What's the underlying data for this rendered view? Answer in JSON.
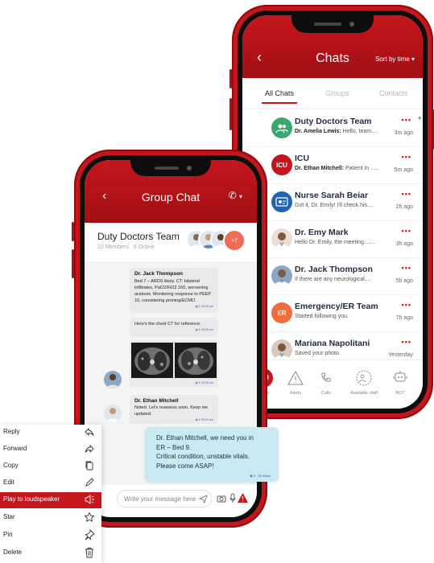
{
  "chats": {
    "title": "Chats",
    "sort_label": "Sort by time",
    "tabs": [
      "All Chats",
      "Groups",
      "Contacts"
    ],
    "rows": [
      {
        "name": "Duty Doctors Team",
        "sender": "Dr. Amelia Lewis:",
        "preview": " Hello, team....",
        "time": "3m ago",
        "dots": "•••",
        "avatar": "group-icon",
        "avatar_color": "#3aa76d",
        "pinned": true
      },
      {
        "name": "ICU",
        "sender": "Dr. Ethan Mitchell:",
        "preview": " Patient in .....",
        "time": "5m ago",
        "dots": "•••",
        "avatar_text": "ICU",
        "avatar_color": "#c4161c"
      },
      {
        "name": "Nurse Sarah Beiar",
        "sender": "",
        "preview": "Got it, Dr. Emily! I'll check his....",
        "time": "2h ago",
        "dots": "•••",
        "avatar": "contact-card-icon",
        "avatar_color": "#1f64b0"
      },
      {
        "name": "Dr. Emy Mark",
        "sender": "",
        "preview": "Hello Dr. Emily, the meeting.......",
        "time": "3h ago",
        "dots": "•••",
        "avatar": "doctor-photo",
        "avatar_color": "#f0dcd2"
      },
      {
        "name": "Dr. Jack Thompson",
        "sender": "",
        "preview": "If there are any neurological....",
        "time": "5h ago",
        "dots": "•••",
        "avatar": "doctor-photo",
        "avatar_color": "#8ca6c6"
      },
      {
        "name": "Emergency/ER Team",
        "sender": "",
        "preview": "Started following you.",
        "time": "7h ago",
        "dots": "•••",
        "avatar_text": "ER",
        "avatar_color": "#f26b3a"
      },
      {
        "name": "Mariana Napolitani",
        "sender": "",
        "preview": "Saved your photo.",
        "time": "Yesterday",
        "dots": "•••",
        "avatar": "doctor-photo",
        "avatar_color": "#d9c9bf"
      }
    ],
    "nav": [
      "Chats",
      "Alerts",
      "Calls",
      "Available staff",
      "BOT"
    ]
  },
  "group": {
    "title": "Group Chat",
    "name": "Duty Doctors Team",
    "members": "10 Members",
    "online": "6 Online",
    "more_count": "+7",
    "messages": [
      {
        "name": "Dr. Jack Thompson",
        "text": "Bed 7 – ARDS likely. CT: bilateral infiltrates, PaO2/FiO2 160, worsening acidosis. Monitoring response to PEEP 10, considering proning/ECMO.",
        "seen": "8",
        "time": "09:30 am"
      },
      {
        "name": "",
        "text": "Here's the chest CT for reference.",
        "seen": "8",
        "time": "09:30 am"
      },
      {
        "name": "",
        "text": "",
        "seen": "8",
        "time": "09:30 am"
      },
      {
        "name": "Dr. Ethan Mitchell",
        "text": "Noted. Let's reassess soon. Keep me updated.",
        "seen": "6",
        "time": "09:31 am"
      }
    ],
    "input_placeholder": "Write your message here"
  },
  "urgent": {
    "text": [
      "Dr. Ethan Mitchell, we need you in",
      "ER – Bed 9.",
      "Critical condition, unstable vitals.",
      "Please come ASAP!"
    ],
    "seen": "9",
    "time": "09:35am"
  },
  "menu": {
    "items": [
      "Reply",
      "Forward",
      "Copy",
      "Edit",
      "Play to loudspeaker",
      "Star",
      "Pin",
      "Delete"
    ],
    "highlighted": "Play to loudspeaker"
  },
  "colors": {
    "brand": "#c4161c",
    "urgent_bubble": "#c9eaf2",
    "navy": "#1f2a44"
  }
}
